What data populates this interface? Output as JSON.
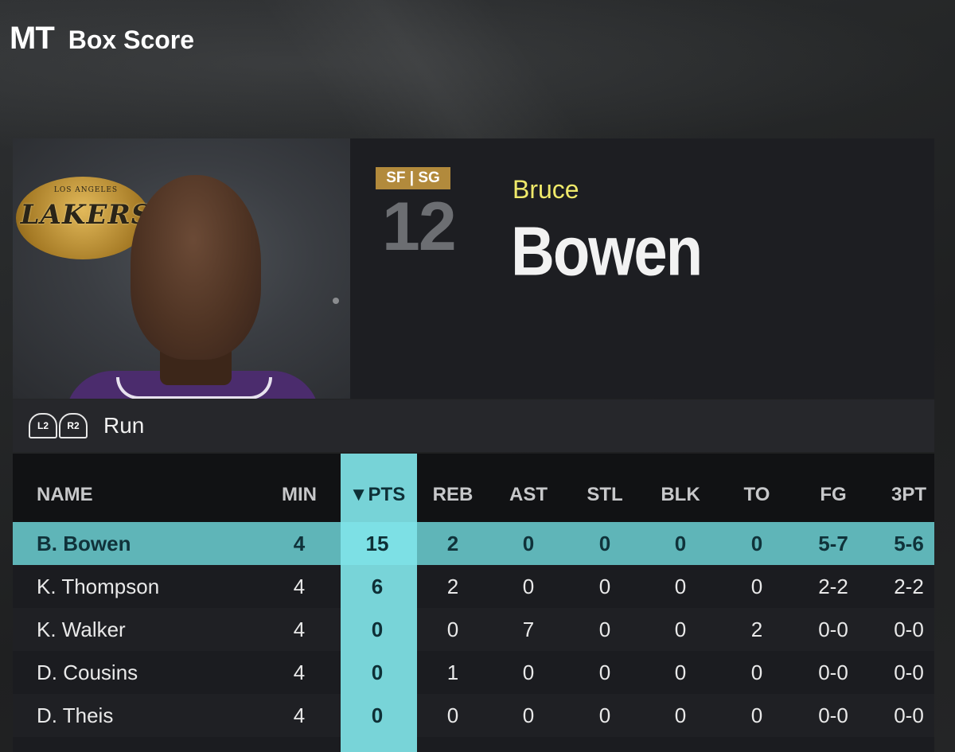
{
  "header": {
    "logo": "MT",
    "title": "Box Score"
  },
  "player": {
    "team_logo_text": "LAKERS",
    "team_logo_sub": "LOS ANGELES",
    "positions": "SF | SG",
    "number": "12",
    "first_name": "Bruce",
    "last_name": "Bowen"
  },
  "run_bar": {
    "left_trigger": "L2",
    "right_trigger": "R2",
    "label": "Run"
  },
  "table": {
    "columns": [
      "NAME",
      "MIN",
      "▼PTS",
      "REB",
      "AST",
      "STL",
      "BLK",
      "TO",
      "FG",
      "3PT"
    ],
    "sorted_column": "PTS",
    "rows": [
      [
        "B. Bowen",
        "4",
        "15",
        "2",
        "0",
        "0",
        "0",
        "0",
        "5-7",
        "5-6"
      ],
      [
        "K. Thompson",
        "4",
        "6",
        "2",
        "0",
        "0",
        "0",
        "0",
        "2-2",
        "2-2"
      ],
      [
        "K. Walker",
        "4",
        "0",
        "0",
        "7",
        "0",
        "0",
        "2",
        "0-0",
        "0-0"
      ],
      [
        "D. Cousins",
        "4",
        "0",
        "1",
        "0",
        "0",
        "0",
        "0",
        "0-0",
        "0-0"
      ],
      [
        "D. Theis",
        "4",
        "0",
        "0",
        "0",
        "0",
        "0",
        "0",
        "0-0",
        "0-0"
      ]
    ],
    "selected_row": 0
  },
  "colors": {
    "accent_teal": "#80e4e8",
    "selected_row": "#5fb5b8",
    "badge_gold": "#b28a3c",
    "first_name_yellow": "#efe96a"
  }
}
